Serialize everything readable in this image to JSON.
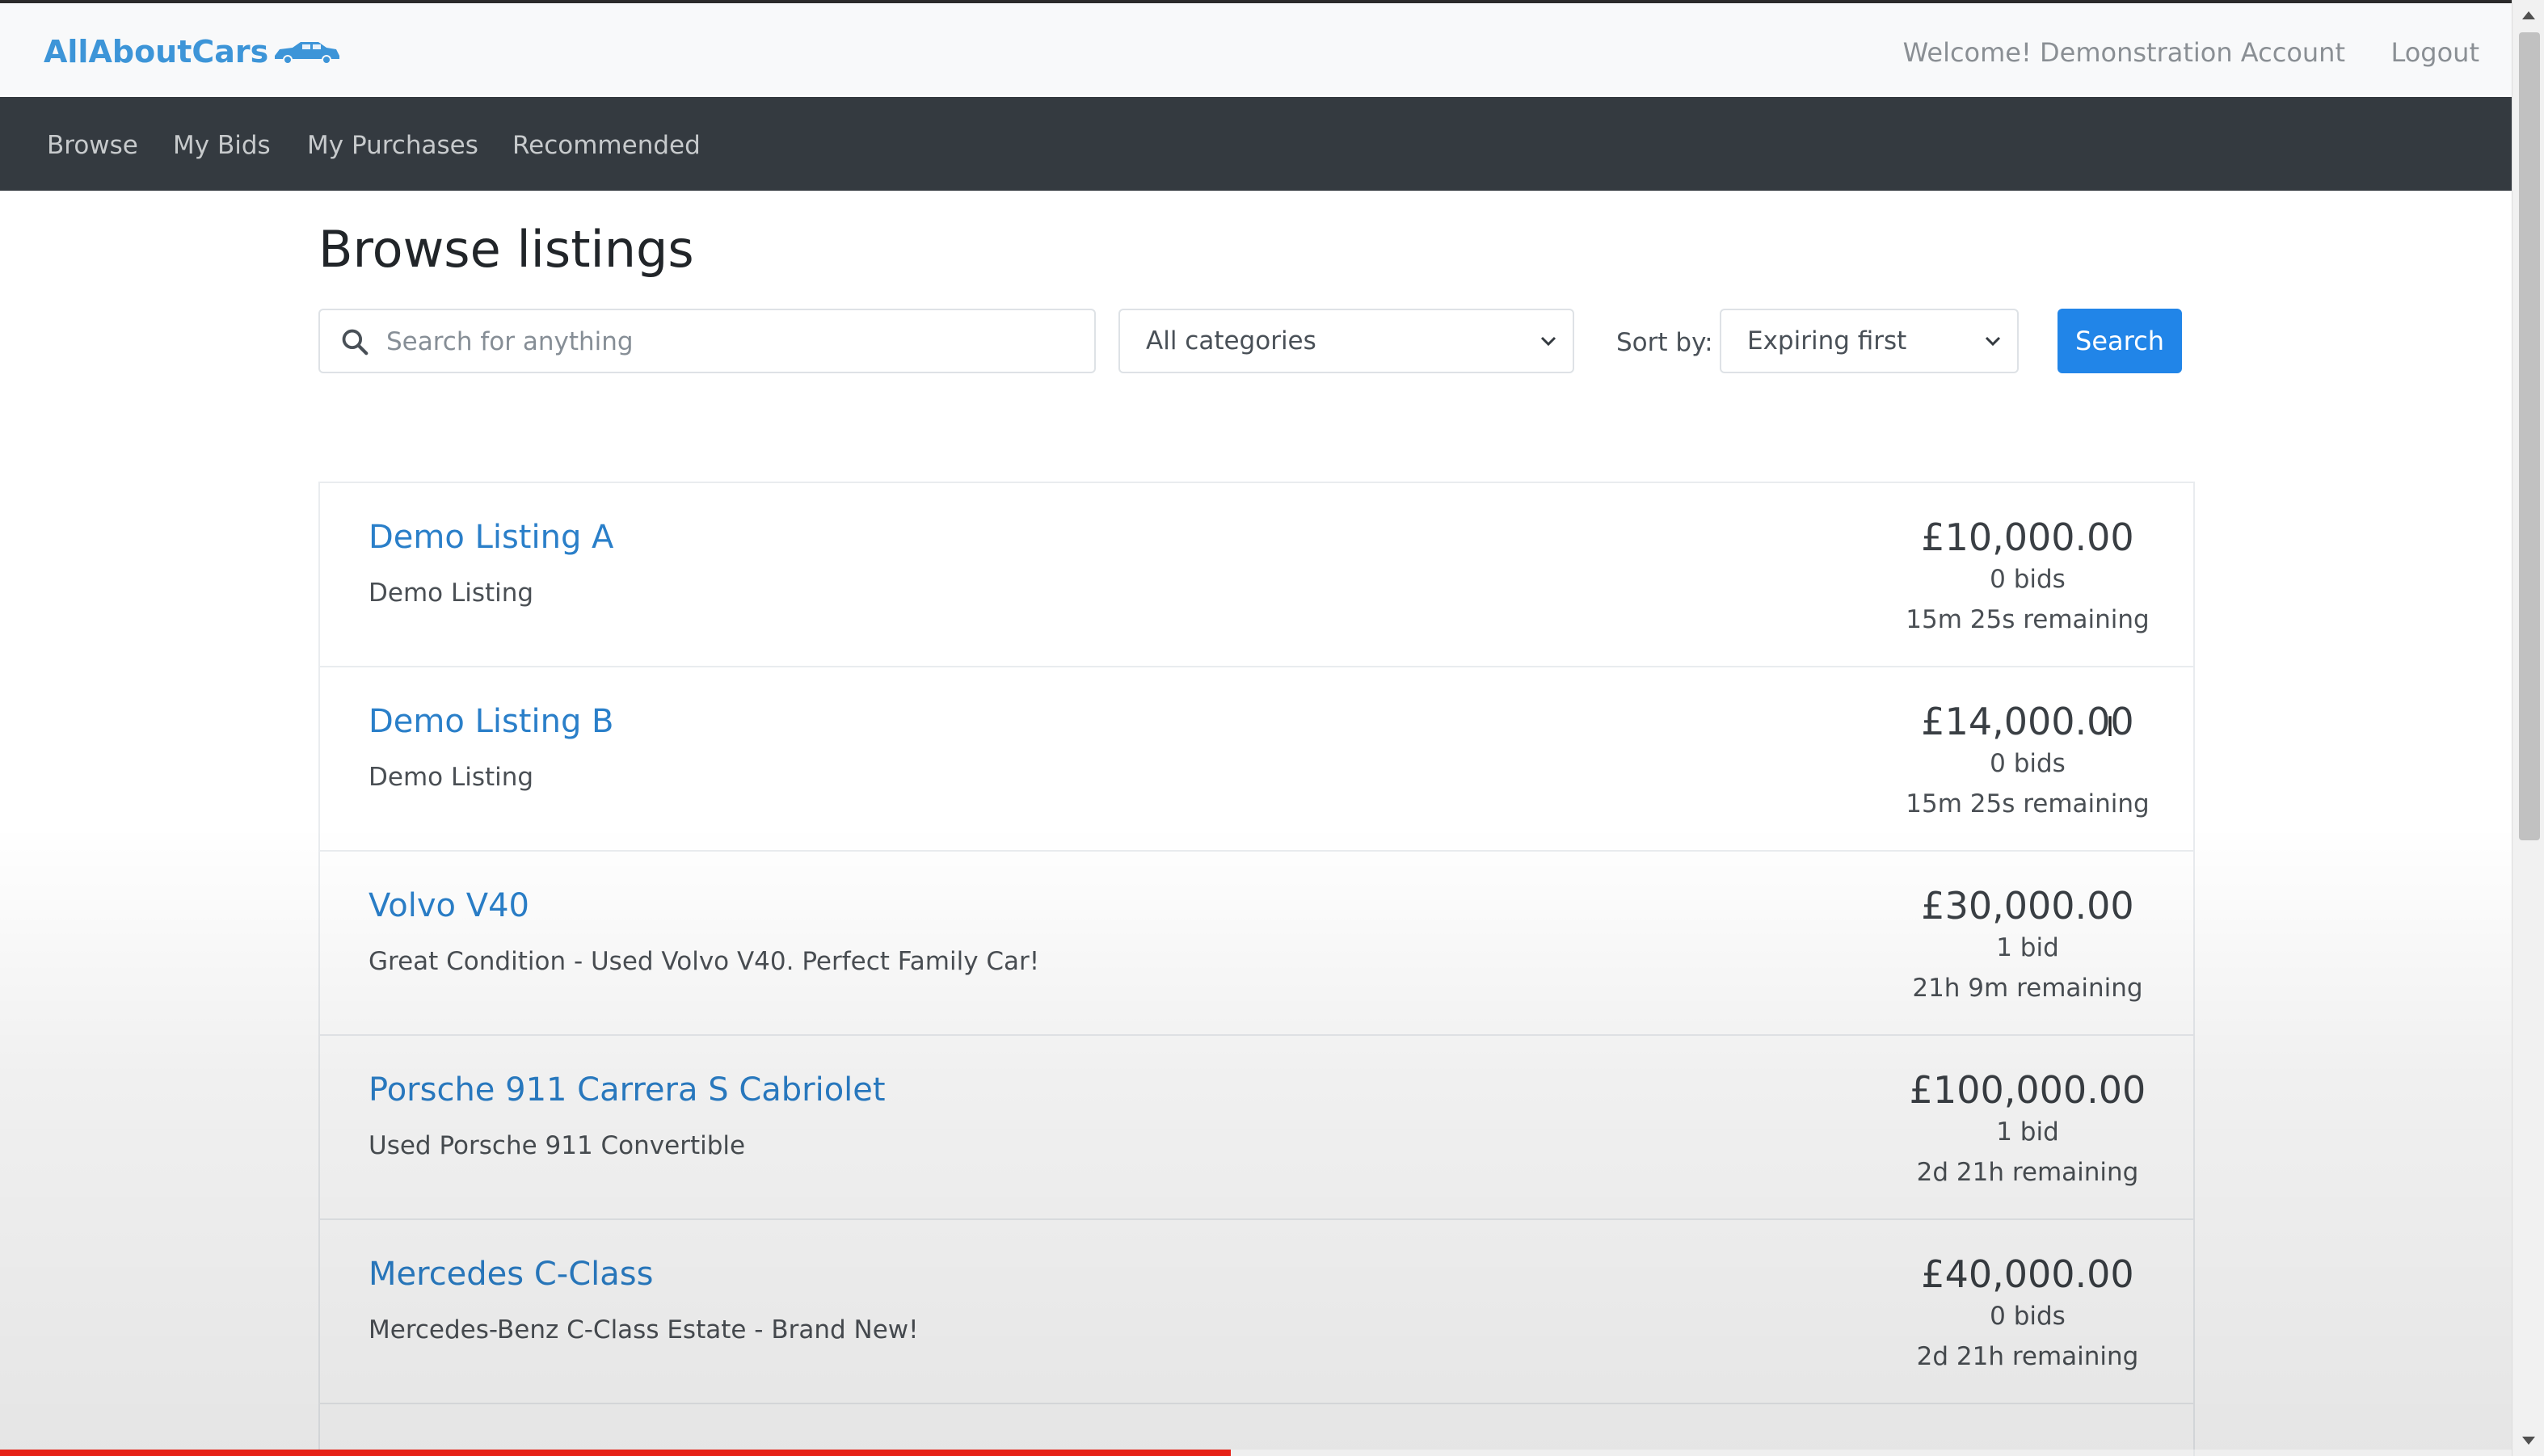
{
  "header": {
    "brand": "AllAboutCars",
    "brand_icon": "car-icon",
    "welcome": "Welcome! Demonstration Account",
    "logout": "Logout"
  },
  "nav": {
    "items": [
      "Browse",
      "My Bids",
      "My Purchases",
      "Recommended"
    ]
  },
  "main": {
    "heading": "Browse listings",
    "search_placeholder": "Search for anything",
    "category_selected": "All categories",
    "sort_label": "Sort by:",
    "sort_selected": "Expiring first",
    "search_button": "Search"
  },
  "listings": [
    {
      "title": "Demo Listing A",
      "description": "Demo Listing",
      "price": "£10,000.00",
      "bids": "0 bids",
      "remaining": "15m 25s remaining"
    },
    {
      "title": "Demo Listing B",
      "description": "Demo Listing",
      "price": "£14,000.00",
      "bids": "0 bids",
      "remaining": "15m 25s remaining"
    },
    {
      "title": "Volvo V40",
      "description": "Great Condition - Used Volvo V40. Perfect Family Car!",
      "price": "£30,000.00",
      "bids": "1 bid",
      "remaining": "21h 9m remaining"
    },
    {
      "title": "Porsche 911 Carrera S Cabriolet",
      "description": "Used Porsche 911 Convertible",
      "price": "£100,000.00",
      "bids": "1 bid",
      "remaining": "2d 21h remaining"
    },
    {
      "title": "Mercedes C-Class",
      "description": "Mercedes-Benz C-Class Estate - Brand New!",
      "price": "£40,000.00",
      "bids": "0 bids",
      "remaining": "2d 21h remaining"
    }
  ],
  "video_progress_fraction": 0.49,
  "colors": {
    "brand": "#3d95d8",
    "nav_background": "#343a40",
    "link": "#2a7fc9",
    "primary_button": "#2185e8",
    "progress": "#e62117"
  }
}
